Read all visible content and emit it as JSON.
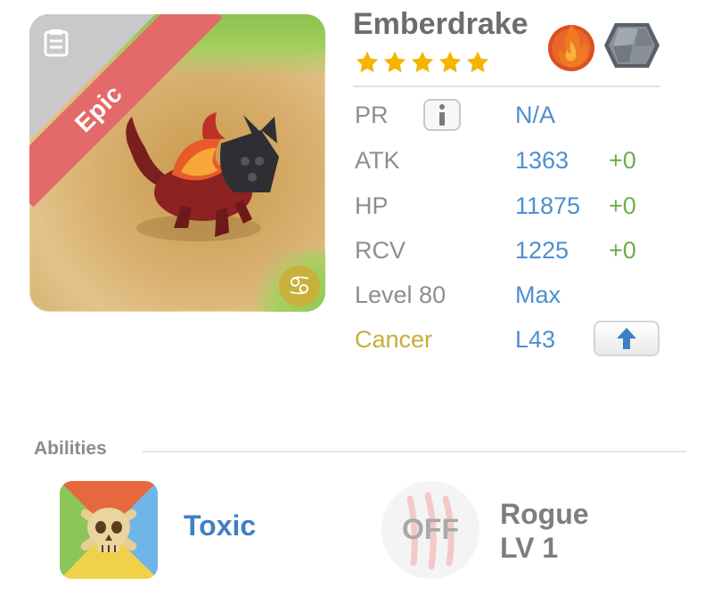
{
  "monster": {
    "name": "Emberdrake",
    "rarity": "Epic",
    "stars": 5,
    "elements": [
      "fire-icon",
      "rock-icon"
    ],
    "zodiac_icon": "cancer-icon"
  },
  "stats": {
    "pr": {
      "label": "PR",
      "value": "N/A"
    },
    "atk": {
      "label": "ATK",
      "value": "1363",
      "bonus": "+0"
    },
    "hp": {
      "label": "HP",
      "value": "11875",
      "bonus": "+0"
    },
    "rcv": {
      "label": "RCV",
      "value": "1225",
      "bonus": "+0"
    },
    "level": {
      "label": "Level 80",
      "value": "Max"
    },
    "zodiac": {
      "label": "Cancer",
      "value": "L43"
    }
  },
  "abilities": {
    "title": "Abilities",
    "active": {
      "name": "Toxic"
    },
    "passive": {
      "status": "OFF",
      "name_line1": "Rogue",
      "name_line2": "LV 1"
    }
  },
  "colors": {
    "stat_value": "#4e8fd0",
    "bonus": "#6cae4c",
    "ribbon": "#e46a6a",
    "zodiac": "#c9ad3a",
    "star": "#f4b400"
  }
}
